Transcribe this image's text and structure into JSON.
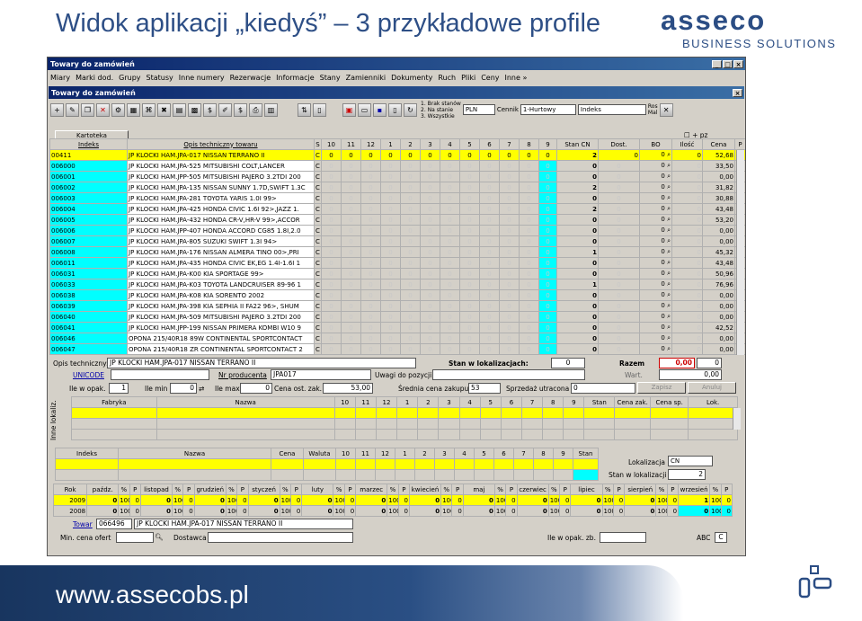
{
  "slide": {
    "title": "Widok aplikacji „kiedyś” – 3 przykładowe profile",
    "logo_word": "asseco",
    "logo_sub": "BUSINESS SOLUTIONS",
    "url": "www.assecobs.pl"
  },
  "window": {
    "title": "Towary do zamówień",
    "sub_title": "Towary do zamówień",
    "menu": [
      "Miary",
      "Marki dod.",
      "Grupy",
      "Statusy",
      "Inne numery",
      "Rezerwacje",
      "Informacje",
      "Stany",
      "Zamienniki",
      "Dokumenty",
      "Ruch",
      "Pliki",
      "Ceny",
      "Inne »"
    ]
  },
  "toolbar": {
    "radio": [
      "1. Brak stanów",
      "2. Na stanie",
      "3. Wszystkie"
    ],
    "currency": "PLN",
    "cennik_label": "Cennik",
    "cennik": "1-Hurtowy",
    "index_sort": "Indeks",
    "rosn": "Ros",
    "mal": "Mal"
  },
  "kartoteka": {
    "label": "Kartoteka",
    "pz": "+ pz"
  },
  "main_grid": {
    "headers": [
      "Indeks",
      "Opis techniczny towaru",
      "S",
      "10",
      "11",
      "12",
      "1",
      "2",
      "3",
      "4",
      "5",
      "6",
      "7",
      "8",
      "9",
      "Stan CN",
      "Dost.",
      "BO",
      "Ilość",
      "Cena",
      "P"
    ],
    "rows": [
      {
        "idx": "00411",
        "desc": "JP KLOCKI HAM.JPA-017 NISSAN TERRANO II",
        "s": "C",
        "stan": "2",
        "dost": "0",
        "bo": "0",
        "ilosc": "0",
        "cena": "52,68"
      },
      {
        "idx": "006000",
        "desc": "JP KLOCKI HAM.JPA-525 MITSUBISHI COLT,LANCER",
        "s": "C",
        "stan": "0",
        "dost": "0",
        "bo": "0",
        "ilosc": "0",
        "cena": "33,50"
      },
      {
        "idx": "006001",
        "desc": "JP KLOCKI HAM.JPP-505 MITSUBISHI PAJERO 3.2TDI 200",
        "s": "C",
        "stan": "0",
        "dost": "0",
        "bo": "0",
        "ilosc": "0",
        "cena": "0,00"
      },
      {
        "idx": "006002",
        "desc": "JP KLOCKI HAM.JPA-135 NISSAN SUNNY 1.7D,SWIFT 1.3C",
        "s": "C",
        "stan": "2",
        "dost": "0",
        "bo": "0",
        "ilosc": "0",
        "cena": "31,82"
      },
      {
        "idx": "006003",
        "desc": "JP KLOCKI HAM.JPA-281 TOYOTA YARIS 1.0I 99>",
        "s": "C",
        "stan": "0",
        "dost": "0",
        "bo": "0",
        "ilosc": "0",
        "cena": "30,88"
      },
      {
        "idx": "006004",
        "desc": "JP KLOCKI HAM.JPA-425 HONDA CIVIC 1.6I 92>,JAZZ 1.",
        "s": "C",
        "stan": "2",
        "dost": "0",
        "bo": "0",
        "ilosc": "0",
        "cena": "43,48"
      },
      {
        "idx": "006005",
        "desc": "JP KLOCKI HAM.JPA-432 HONDA CR-V,HR-V 99>,ACCOR",
        "s": "C",
        "stan": "0",
        "dost": "0",
        "bo": "0",
        "ilosc": "0",
        "cena": "53,20"
      },
      {
        "idx": "006006",
        "desc": "JP KLOCKI HAM.JPP-407 HONDA ACCORD CG85 1.8I,2.0",
        "s": "C",
        "stan": "0",
        "dost": "0",
        "bo": "0",
        "ilosc": "0",
        "cena": "0,00"
      },
      {
        "idx": "006007",
        "desc": "JP KLOCKI HAM.JPA-805 SUZUKI SWIFT 1.3I 94>",
        "s": "C",
        "stan": "0",
        "dost": "0",
        "bo": "0",
        "ilosc": "0",
        "cena": "0,00"
      },
      {
        "idx": "006008",
        "desc": "JP KLOCKI HAM.JPA-176 NISSAN ALMERA TINO 00>,PRI",
        "s": "C",
        "stan": "1",
        "dost": "0",
        "bo": "0",
        "ilosc": "0",
        "cena": "45,32"
      },
      {
        "idx": "006011",
        "desc": "JP KLOCKI HAM.JPA-435 HONDA CIVIC EK,EG 1.4I-1.6I 1",
        "s": "C",
        "stan": "0",
        "dost": "0",
        "bo": "0",
        "ilosc": "0",
        "cena": "43,48"
      },
      {
        "idx": "006031",
        "desc": "JP KLOCKI HAM.JPA-K00 KIA SPORTAGE 99>",
        "s": "C",
        "stan": "0",
        "dost": "0",
        "bo": "0",
        "ilosc": "0",
        "cena": "50,96"
      },
      {
        "idx": "006033",
        "desc": "JP KLOCKI HAM.JPA-K03 TOYOTA LANDCRUISER 89-96 1",
        "s": "C",
        "stan": "1",
        "dost": "0",
        "bo": "0",
        "ilosc": "0",
        "cena": "76,96"
      },
      {
        "idx": "006038",
        "desc": "JP KLOCKI HAM.JPA-K08 KIA SORENTO 2002",
        "s": "C",
        "stan": "0",
        "dost": "0",
        "bo": "0",
        "ilosc": "0",
        "cena": "0,00"
      },
      {
        "idx": "006039",
        "desc": "JP KLOCKI HAM.JPA-398 KIA SEPHIA II FA22 96>, SHUM",
        "s": "C",
        "stan": "0",
        "dost": "0",
        "bo": "0",
        "ilosc": "0",
        "cena": "0,00"
      },
      {
        "idx": "006040",
        "desc": "JP KLOCKI HAM.JPA-509 MITSUBISHI PAJERO 3.2TDI 200",
        "s": "C",
        "stan": "0",
        "dost": "0",
        "bo": "0",
        "ilosc": "0",
        "cena": "0,00"
      },
      {
        "idx": "006041",
        "desc": "JP KLOCKI HAM.JPP-199 NISSAN PRIMERA KOMBI W10 9",
        "s": "C",
        "stan": "0",
        "dost": "0",
        "bo": "0",
        "ilosc": "0",
        "cena": "42,52"
      },
      {
        "idx": "006046",
        "desc": "OPONA 215/40R18 89W CONTINENTAL SPORTCONTACT",
        "s": "C",
        "stan": "0",
        "dost": "0",
        "bo": "0",
        "ilosc": "0",
        "cena": "0,00"
      },
      {
        "idx": "006047",
        "desc": "OPONA 215/40R18 ZR CONTINENTAL SPORTCONTACT 2",
        "s": "C",
        "stan": "0",
        "dost": "0",
        "bo": "0",
        "ilosc": "0",
        "cena": "0,00"
      }
    ]
  },
  "detail": {
    "opis_label": "Opis techniczny:",
    "opis": "JP KLOCKI HAM.JPA-017 NISSAN TERRANO II",
    "stan_lok_label": "Stan w lokalizacjach:",
    "stan_lok": "0",
    "razem_label": "Razem",
    "razem": "0,00",
    "razem2": "0",
    "wart_label": "Wart.",
    "wart": "0,00",
    "unicode_label": "UNICODE",
    "nr_prod_label": "Nr producenta",
    "nr_prod": "JPA017",
    "uwagi_label": "Uwagi do pozycji",
    "ile_opak_label": "Ile w opak.",
    "ile_opak": "1",
    "ile_min_label": "Ile min",
    "ile_min": "0",
    "ile_max_label": "Ile max",
    "ile_max": "0",
    "cena_ost_label": "Cena ost. zak.",
    "cena_ost": "53,00",
    "srednia_label": "Średnia cena zakupu",
    "srednia": "53",
    "sprzedaz_label": "Sprzedaż utracona",
    "sprzedaz": "0",
    "zapisz": "Zapisz",
    "anuluj": "Anuluj"
  },
  "supplier_grid": {
    "side_label": "Inne lokaliz.",
    "headers": [
      "Fabryka",
      "Nazwa",
      "10",
      "11",
      "12",
      "1",
      "2",
      "3",
      "4",
      "5",
      "6",
      "7",
      "8",
      "9",
      "Stan",
      "Cena zak.",
      "Cena sp.",
      "Lok."
    ]
  },
  "index_grid": {
    "headers": [
      "Indeks",
      "Nazwa",
      "Cena",
      "Waluta",
      "10",
      "11",
      "12",
      "1",
      "2",
      "3",
      "4",
      "5",
      "6",
      "7",
      "8",
      "9",
      "Stan"
    ],
    "lokalizacja_label": "Lokalizacja",
    "lokalizacja": "CN",
    "stan_lok_label": "Stan w lokalizacji",
    "stan_lok": "2"
  },
  "year_grid": {
    "headers": [
      "Rok",
      "paźdz.",
      "%",
      "P",
      "listopad",
      "%",
      "P",
      "grudzień",
      "%",
      "P",
      "styczeń",
      "%",
      "P",
      "luty",
      "%",
      "P",
      "marzec",
      "%",
      "P",
      "kwiecień",
      "%",
      "P",
      "maj",
      "%",
      "P",
      "czerwiec",
      "%",
      "P",
      "lipiec",
      "%",
      "P",
      "sierpień",
      "%",
      "P",
      "wrzesień",
      "%",
      "P"
    ],
    "rows": [
      {
        "rok": "2009",
        "vals": [
          "0",
          "100",
          "0",
          "0",
          "100",
          "0",
          "0",
          "100",
          "0",
          "0",
          "100",
          "0",
          "0",
          "100",
          "0",
          "0",
          "100",
          "0",
          "0",
          "100",
          "0",
          "0",
          "100",
          "0",
          "0",
          "100",
          "0",
          "0",
          "100",
          "0",
          "0",
          "100",
          "0",
          "1",
          "100",
          "0"
        ]
      },
      {
        "rok": "2008",
        "vals": [
          "0",
          "100",
          "0",
          "0",
          "100",
          "0",
          "0",
          "100",
          "0",
          "0",
          "100",
          "0",
          "0",
          "100",
          "0",
          "0",
          "100",
          "0",
          "0",
          "100",
          "0",
          "0",
          "100",
          "0",
          "0",
          "100",
          "0",
          "0",
          "100",
          "0",
          "0",
          "100",
          "0",
          "0",
          "100",
          "0"
        ]
      }
    ]
  },
  "bottom": {
    "towar_label": "Towar",
    "towar_idx": "066496",
    "towar_desc": "JP KLOCKI HAM.JPA-017 NISSAN TERRANO II",
    "min_cena_label": "Min. cena ofert",
    "dostawca_label": "Dostawca",
    "ile_opak_zb_label": "Ile w opak. zb.",
    "abc_label": "ABC",
    "abc": "C"
  }
}
